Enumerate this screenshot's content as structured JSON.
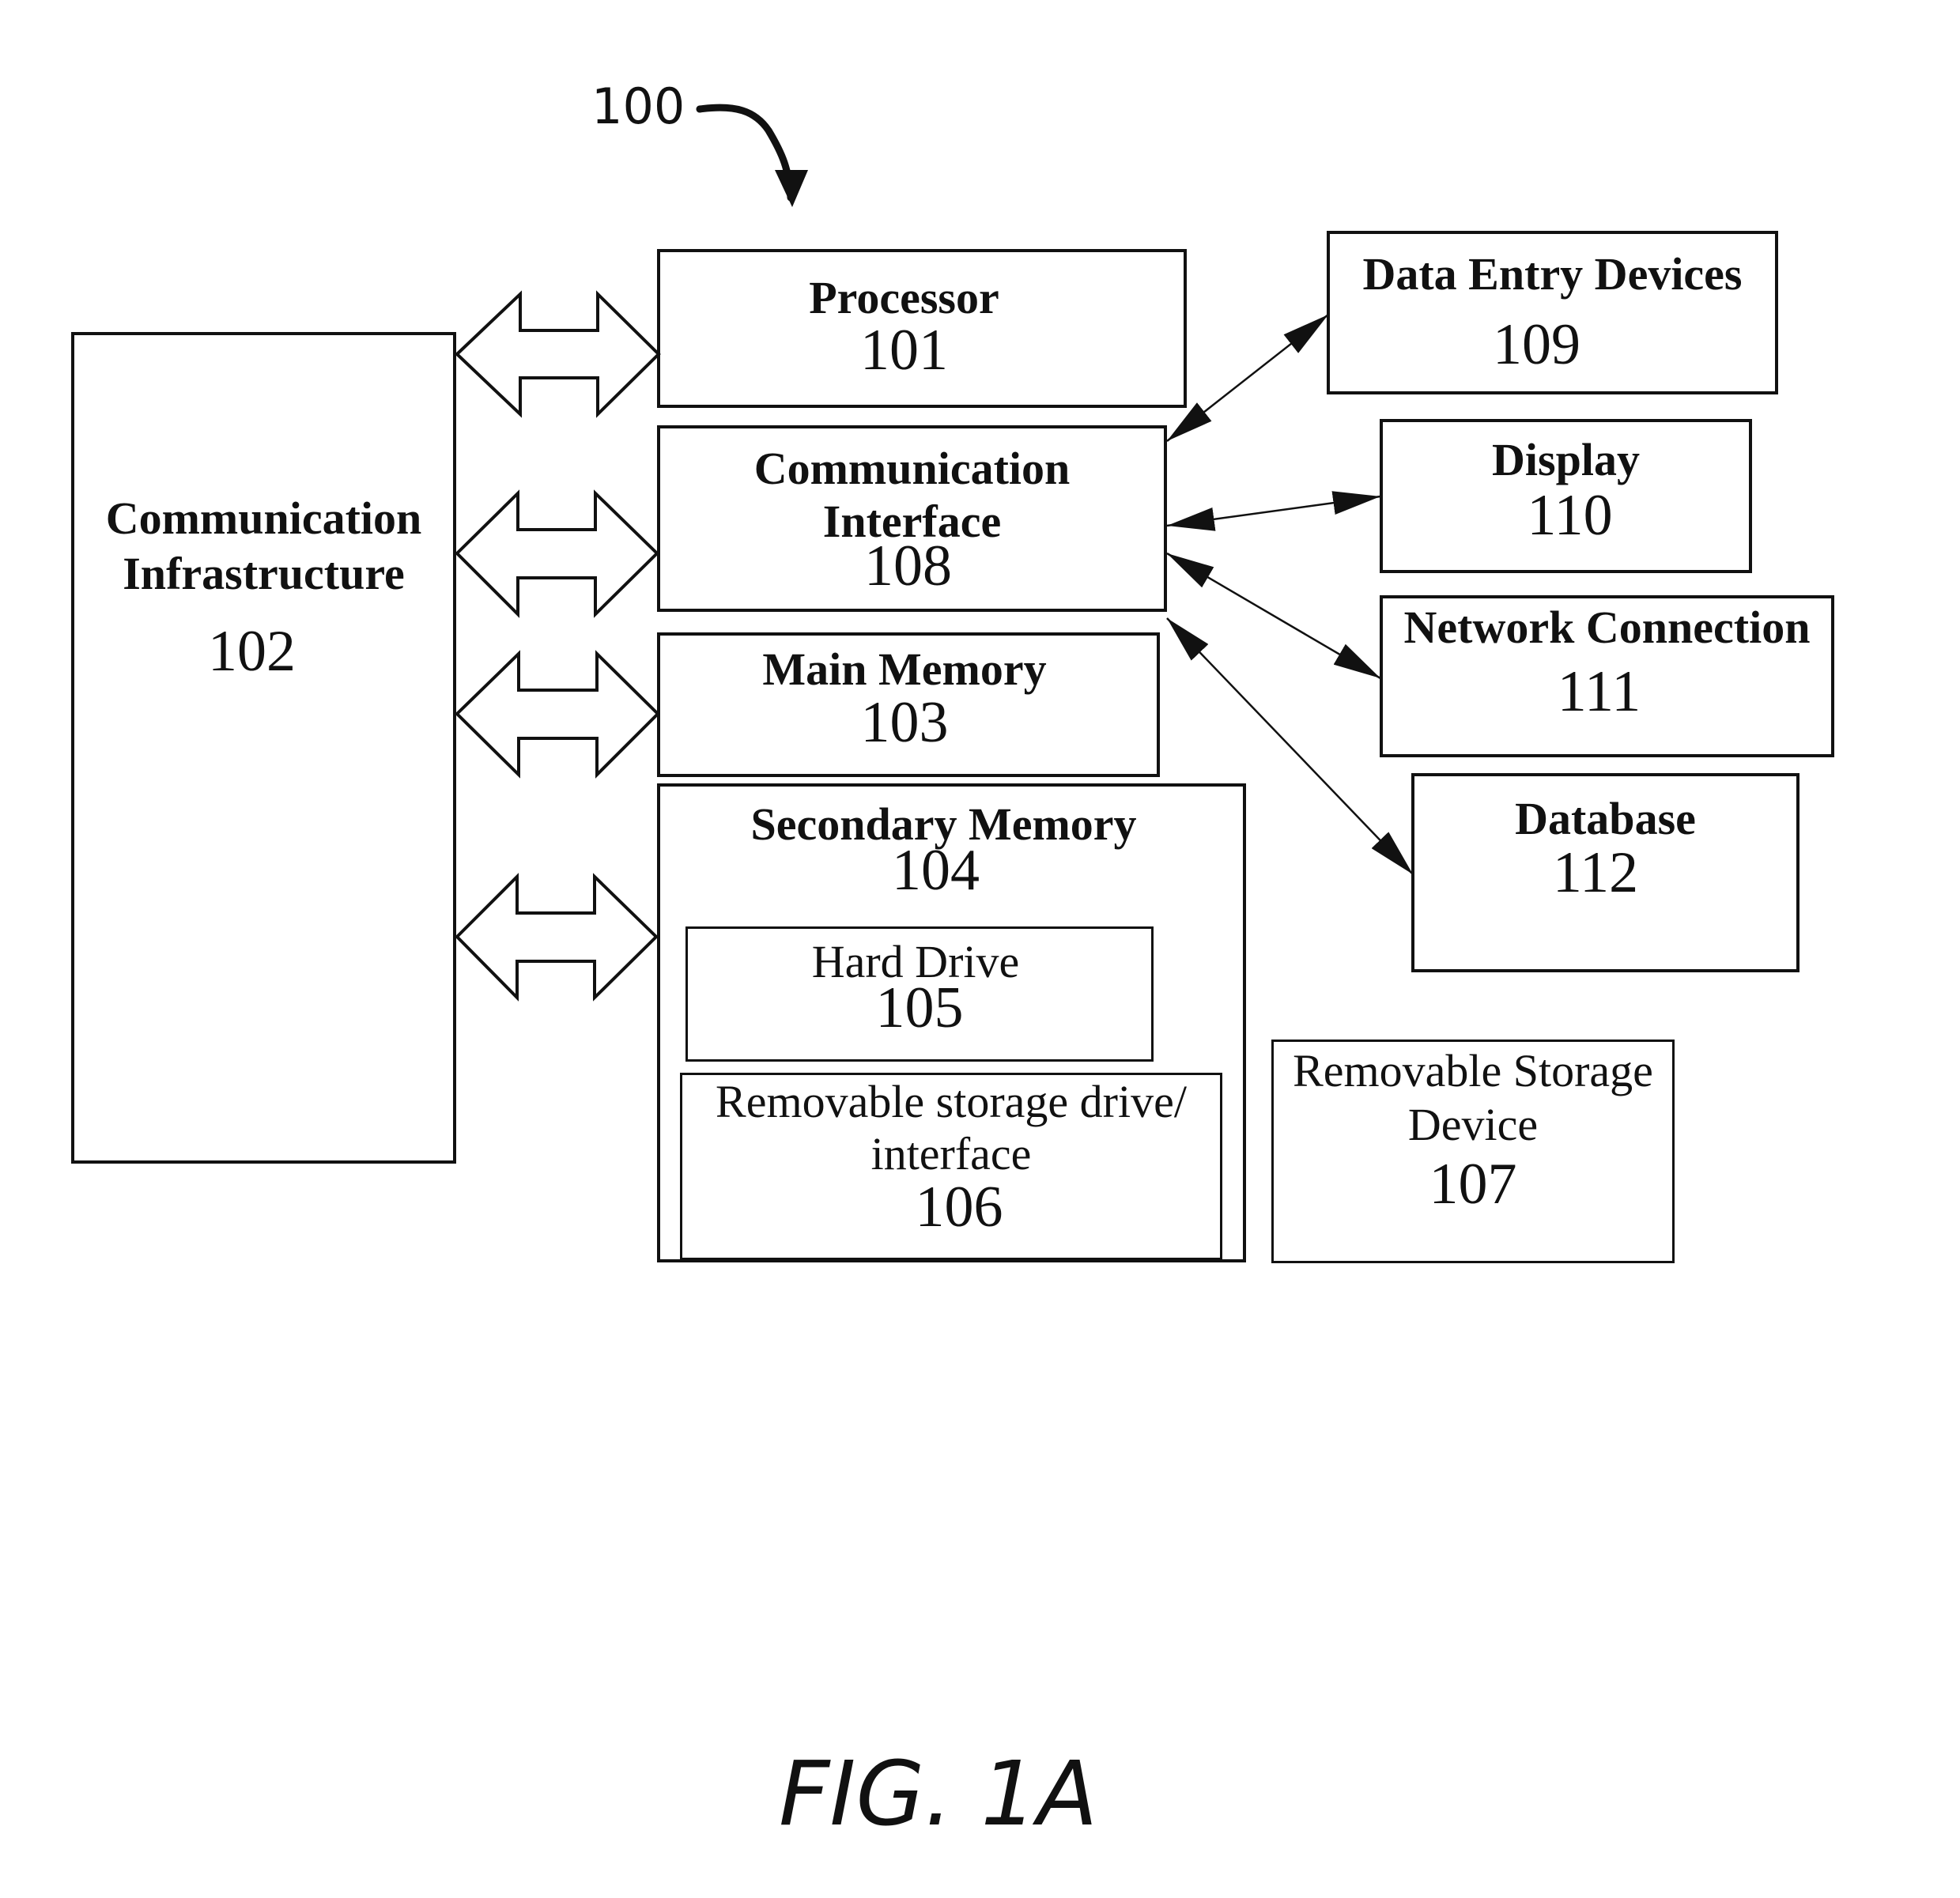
{
  "figure": {
    "reference_number": "100",
    "caption": "FIG. 1A"
  },
  "blocks": {
    "communication_infrastructure": {
      "title_line1": "Communication",
      "title_line2": "Infrastructure",
      "number": "102"
    },
    "processor": {
      "title": "Processor",
      "number": "101"
    },
    "communication_interface": {
      "title_line1": "Communication",
      "title_line2": "Interface",
      "number": "108"
    },
    "main_memory": {
      "title": "Main Memory",
      "number": "103"
    },
    "secondary_memory": {
      "title": "Secondary Memory",
      "number": "104"
    },
    "hard_drive": {
      "title": "Hard Drive",
      "number": "105"
    },
    "removable_storage_drive": {
      "title_line1": "Removable storage drive/",
      "title_line2": "interface",
      "number": "106"
    },
    "removable_storage_device": {
      "title_line1": "Removable Storage",
      "title_line2": "Device",
      "number": "107"
    },
    "data_entry_devices": {
      "title": "Data Entry Devices",
      "number": "109"
    },
    "display": {
      "title": "Display",
      "number": "110"
    },
    "network_connection": {
      "title": "Network Connection",
      "number": "111"
    },
    "database": {
      "title": "Database",
      "number": "112"
    }
  }
}
